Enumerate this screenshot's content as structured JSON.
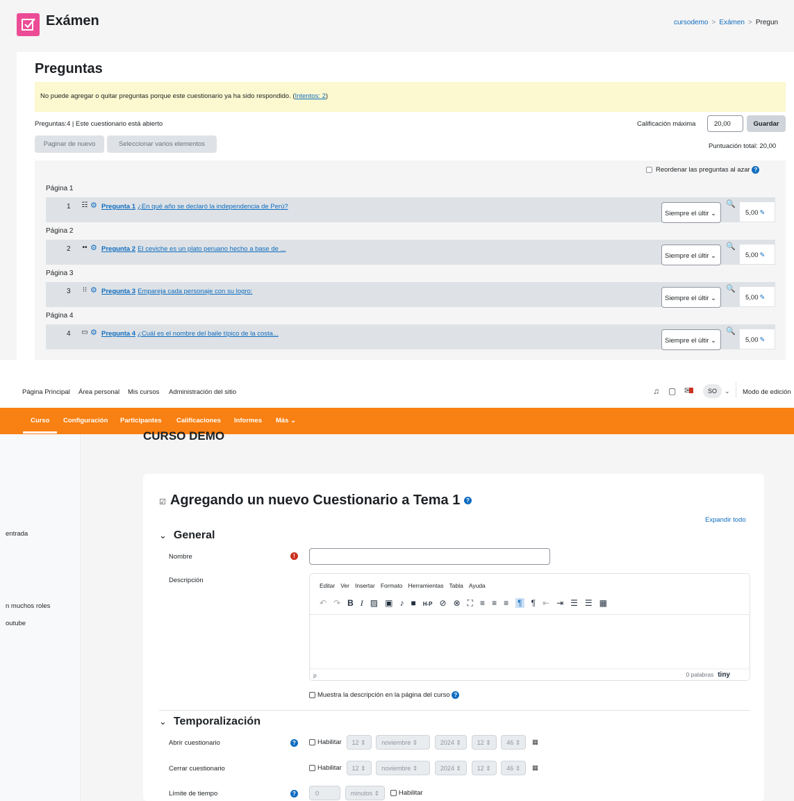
{
  "top": {
    "title": "Exámen",
    "breadcrumb": [
      "cursodemo",
      "Exámen",
      "Pregun"
    ],
    "heading": "Preguntas",
    "warning": "No puede agregar o quitar preguntas porque este cuestionario ya ha sido respondido. (",
    "warning_link": "Intentos: 2",
    "warning_end": ")",
    "info": "Preguntas:4 | Este cuestionario está abierto",
    "max_grade_label": "Calificación máxima",
    "max_grade_value": "20,00",
    "save": "Guardar",
    "repaginate": "Paginar de nuevo",
    "select_multiple": "Seleccionar varios elementos",
    "total": "Puntuación total: 20,00",
    "shuffle": "Reordenar las preguntas al azar",
    "pages": [
      "Página 1",
      "Página 2",
      "Página 3",
      "Página 4"
    ],
    "questions": [
      {
        "num": "1",
        "type_icon": "list-icon",
        "title": "Pregunta 1",
        "text": "¿En qué año se declaró la independencia de Perú?",
        "select": "Siempre el últir",
        "mark": "5,00"
      },
      {
        "num": "2",
        "type_icon": "dots-icon",
        "title": "Pregunta 2",
        "text": "El ceviche es un plato peruano hecho a base de ...",
        "select": "Siempre el últir",
        "mark": "5,00"
      },
      {
        "num": "3",
        "type_icon": "match-icon",
        "title": "Pregunta 3",
        "text": "Empareja cada personaje con su logro:",
        "select": "Siempre el últir",
        "mark": "5,00"
      },
      {
        "num": "4",
        "type_icon": "short-answer-icon",
        "title": "Pregunta 4",
        "text": "¿Cuál es el nombre del baile típico de la costa...",
        "select": "Siempre el últir",
        "mark": "5,00"
      }
    ]
  },
  "nav": {
    "items": [
      "Página Principal",
      "Área personal",
      "Mis cursos",
      "Administración del sitio"
    ],
    "avatar": "SO",
    "edit_mode": "Modo de edición",
    "tabs": [
      "Curso",
      "Configuración",
      "Participantes",
      "Calificaciones",
      "Informes",
      "Más"
    ]
  },
  "rail": [
    "entrada",
    "n muchos roles",
    "outube"
  ],
  "course_title": "CURSO DEMO",
  "form": {
    "heading": "Agregando un nuevo Cuestionario a Tema 1",
    "expand_all": "Expandir todo",
    "section_general": "General",
    "name_label": "Nombre",
    "desc_label": "Descripción",
    "editor_menu": [
      "Editar",
      "Ver",
      "Insertar",
      "Formato",
      "Herramientas",
      "Tabla",
      "Ayuda"
    ],
    "editor_status_p": "p",
    "editor_words": "0 palabras",
    "editor_brand": "tiny",
    "show_desc": "Muestra la descripción en la página del curso",
    "section_timing": "Temporalización",
    "open_label": "Abrir cuestionario",
    "close_label": "Cerrar cuestionario",
    "limit_label": "Límite de tiempo",
    "enable": "Habilitar",
    "day": "12",
    "month": "noviembre",
    "year": "2024",
    "hour": "12",
    "minute": "46",
    "limit_value": "0",
    "limit_unit": "minutos"
  }
}
